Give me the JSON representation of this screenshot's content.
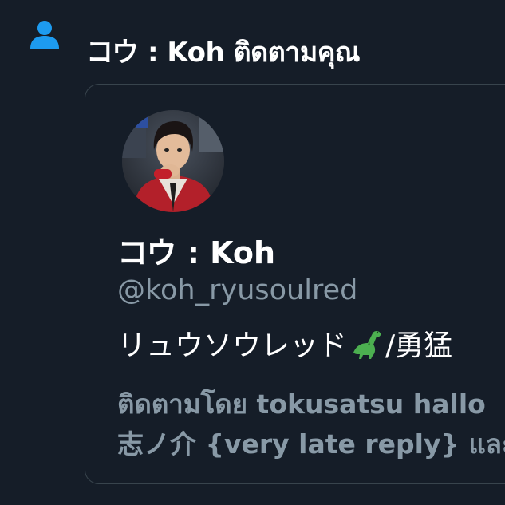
{
  "notification": {
    "icon": "person-icon",
    "icon_color": "#1d9bf0",
    "headline": "コウ : Koh ติดตามคุณ"
  },
  "profile_card": {
    "avatar": "profile-avatar",
    "display_name": "コウ : Koh",
    "handle": "@koh_ryusoulred",
    "bio_text_before": "リュウソウレッド",
    "bio_emoji": "dinosaur-emoji",
    "bio_text_after": "/勇猛",
    "followed_by_line1": "ติดตามโดย tokusatsu hallo",
    "followed_by_line2": "志ノ介 {very late reply} และ"
  },
  "colors": {
    "background": "#151d28",
    "border": "#38444d",
    "secondary_text": "#8899a6",
    "primary_text": "#ffffff"
  }
}
